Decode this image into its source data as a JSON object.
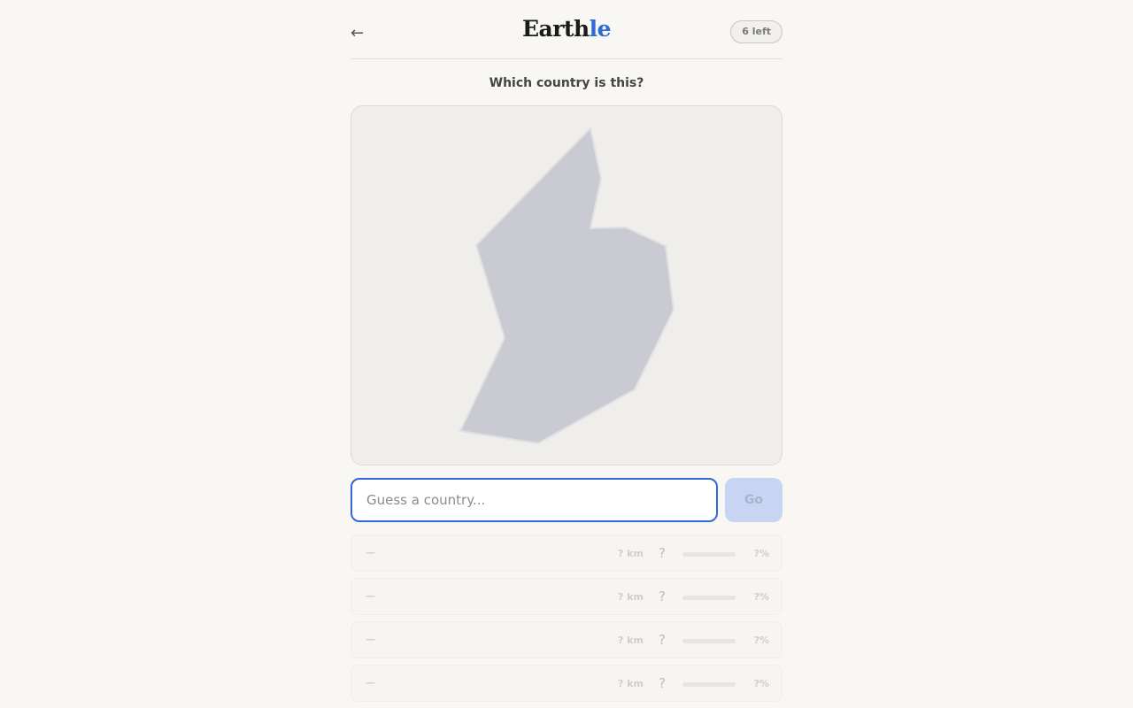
{
  "header": {
    "back_icon": "←",
    "logo_main": "Earth",
    "logo_accent": "le",
    "remaining": "6 left"
  },
  "question": "Which country is this?",
  "guess": {
    "placeholder": "Guess a country...",
    "value": "",
    "go_label": "Go"
  },
  "slots": [
    {
      "name": "—",
      "distance": "? km",
      "direction": "?",
      "percent": "?%",
      "proximity": 0
    },
    {
      "name": "—",
      "distance": "? km",
      "direction": "?",
      "percent": "?%",
      "proximity": 0
    },
    {
      "name": "—",
      "distance": "? km",
      "direction": "?",
      "percent": "?%",
      "proximity": 0
    },
    {
      "name": "—",
      "distance": "? km",
      "direction": "?",
      "percent": "?%",
      "proximity": 0
    }
  ],
  "colors": {
    "accent": "#2f6ad8",
    "silhouette": "#cacbd2",
    "background": "#f8f7f4"
  }
}
